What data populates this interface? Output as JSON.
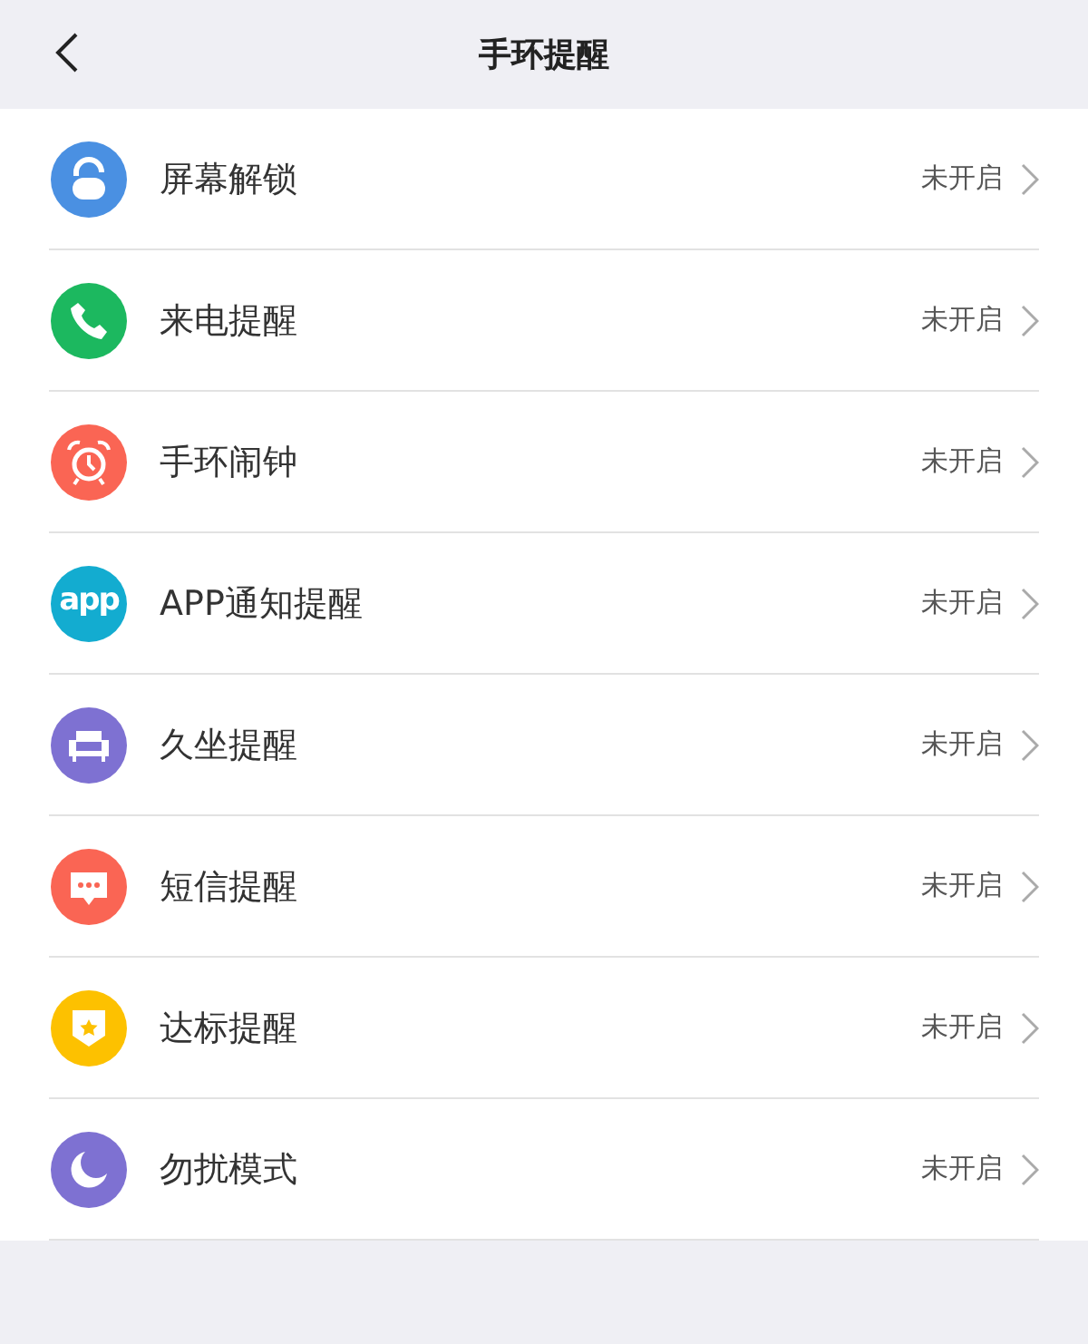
{
  "header": {
    "title": "手环提醒"
  },
  "items": [
    {
      "kind": "lock",
      "color": "#4a90e2",
      "label": "屏幕解锁",
      "status": "未开启"
    },
    {
      "kind": "phone",
      "color": "#1cb85f",
      "label": "来电提醒",
      "status": "未开启"
    },
    {
      "kind": "alarm",
      "color": "#fa6554",
      "label": "手环闹钟",
      "status": "未开启"
    },
    {
      "kind": "text",
      "color": "#13acd0",
      "icon_text": "app",
      "label": "APP通知提醒",
      "status": "未开启"
    },
    {
      "kind": "sofa",
      "color": "#7e71d2",
      "label": "久坐提醒",
      "status": "未开启"
    },
    {
      "kind": "message",
      "color": "#fa6554",
      "label": "短信提醒",
      "status": "未开启"
    },
    {
      "kind": "badge",
      "color": "#fdc100",
      "label": "达标提醒",
      "status": "未开启"
    },
    {
      "kind": "moon",
      "color": "#7e71d2",
      "label": "勿扰模式",
      "status": "未开启"
    }
  ]
}
